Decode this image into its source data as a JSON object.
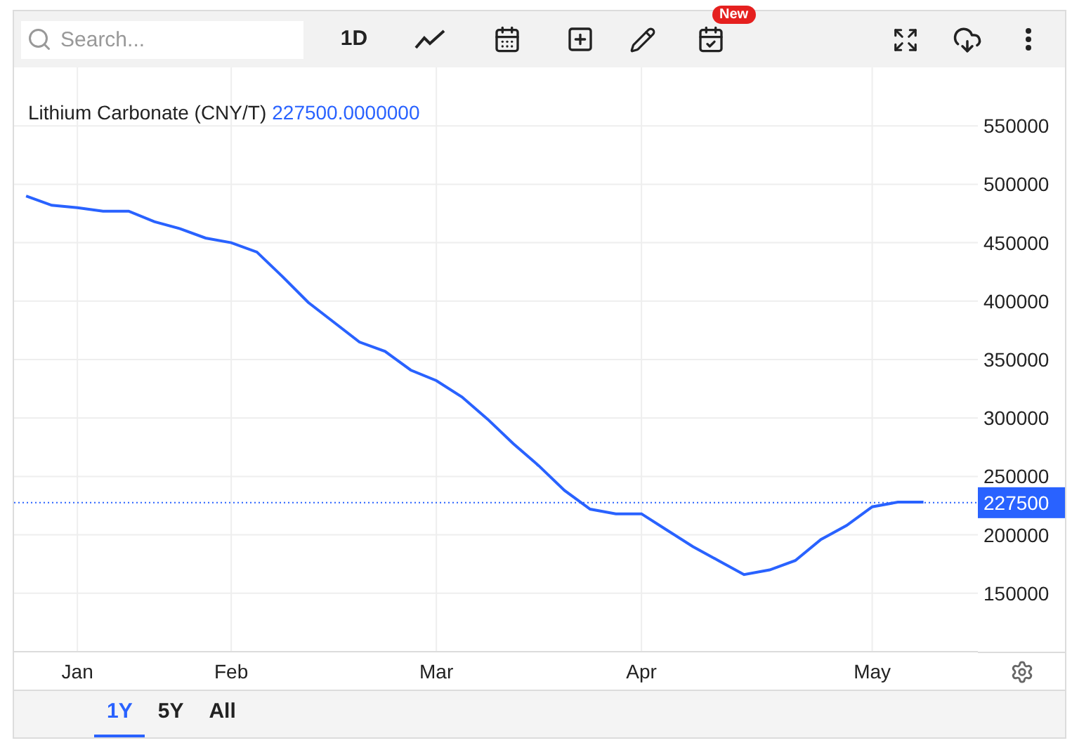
{
  "toolbar": {
    "search": {
      "placeholder": "Search..."
    },
    "interval": "1D",
    "new_badge": "New"
  },
  "chart": {
    "legend": {
      "value": "227500.0000000"
    },
    "current_label": "227500",
    "chart_data": {
      "type": "line",
      "grid": true,
      "ylim": [
        100000,
        600000
      ],
      "ref_lines": [
        {
          "axis": "y",
          "value": 227500,
          "color": "#2962ff"
        }
      ],
      "categories": [
        null,
        null,
        null,
        "Jan",
        null,
        null,
        null,
        null,
        null,
        "Feb",
        null,
        null,
        null,
        null,
        null,
        null,
        null,
        "Mar",
        null,
        null,
        null,
        null,
        null,
        null,
        null,
        "Apr",
        null,
        null,
        null,
        null,
        null,
        null,
        null,
        null,
        "May",
        null,
        null
      ],
      "yticks": [
        150000,
        200000,
        250000,
        300000,
        350000,
        400000,
        450000,
        500000,
        550000
      ],
      "series": [
        {
          "name": "Lithium Carbonate (CNY/T)",
          "color": "#2962ff",
          "values": [
            null,
            490000,
            482000,
            480000,
            477000,
            477000,
            468000,
            462000,
            454000,
            450000,
            442000,
            421000,
            399000,
            382000,
            365000,
            357000,
            341000,
            332000,
            318000,
            299000,
            278000,
            259000,
            238000,
            222000,
            218000,
            218000,
            204000,
            190000,
            178000,
            166000,
            170000,
            178000,
            196000,
            208000,
            224000,
            228000,
            228000
          ]
        }
      ]
    }
  },
  "ranges": [
    {
      "label": "1Y",
      "selected": true
    },
    {
      "label": "5Y",
      "selected": false
    },
    {
      "label": "All",
      "selected": false
    }
  ]
}
